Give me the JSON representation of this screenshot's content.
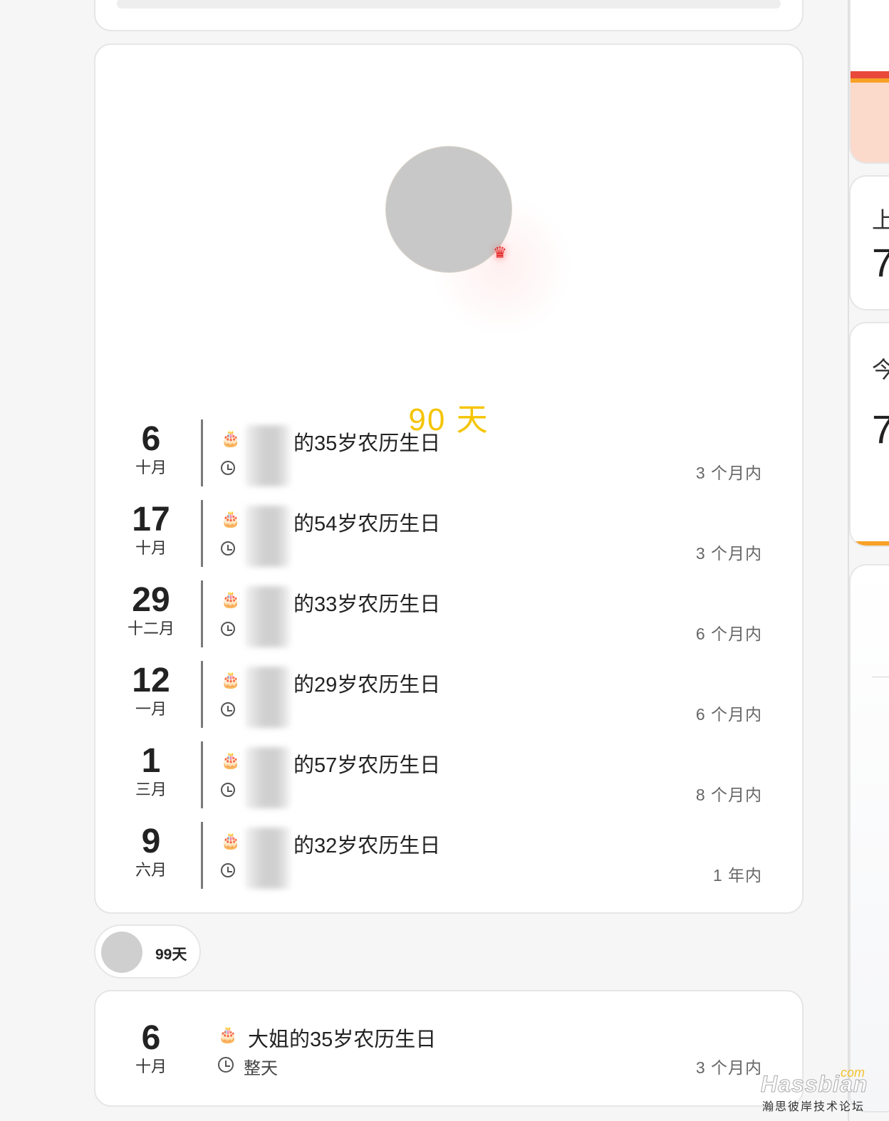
{
  "countdown": {
    "days_text": "90 天"
  },
  "events": [
    {
      "day": "6",
      "month": "十月",
      "title": "的35岁农历生日",
      "relative": "3 个月内"
    },
    {
      "day": "17",
      "month": "十月",
      "title": "的54岁农历生日",
      "relative": "3 个月内"
    },
    {
      "day": "29",
      "month": "十二月",
      "title": "的33岁农历生日",
      "relative": "6 个月内"
    },
    {
      "day": "12",
      "month": "一月",
      "title": "的29岁农历生日",
      "relative": "6 个月内"
    },
    {
      "day": "1",
      "month": "三月",
      "title": "的57岁农历生日",
      "relative": "8 个月内"
    },
    {
      "day": "9",
      "month": "六月",
      "title": "的32岁农历生日",
      "relative": "1 年内"
    }
  ],
  "chip": {
    "label": "99天"
  },
  "next_event": {
    "day": "6",
    "month": "十月",
    "title": "大姐的35岁农历生日",
    "all_day": "整天",
    "relative": "3 个月内"
  },
  "right_column": {
    "card2_label": "上",
    "card2_value": "7",
    "card3_label": "今",
    "card3_value": "7"
  },
  "watermark": {
    "com": "com",
    "brand": "Hassbian",
    "subtitle": "瀚思彼岸技术论坛"
  },
  "icons": {
    "cake": "🎂",
    "clock": "clock-icon"
  },
  "colors": {
    "accent_yellow": "#f5c400",
    "stripe_red": "#e8493a",
    "stripe_orange": "#f7a126"
  }
}
